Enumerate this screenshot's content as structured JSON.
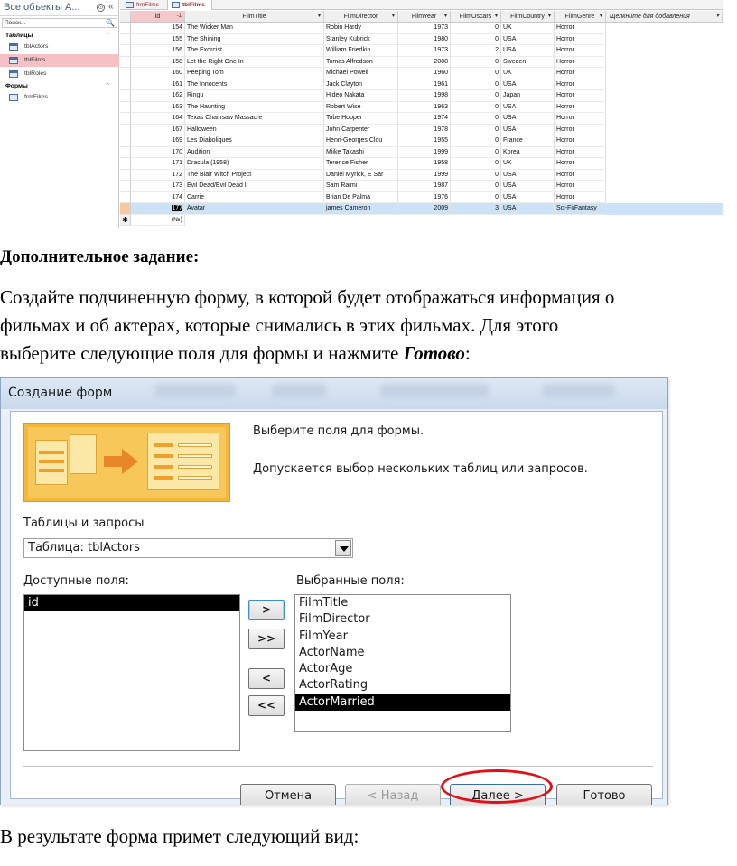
{
  "access": {
    "nav": {
      "title": "Все объекты A...",
      "ctl_circle": "⊙",
      "ctl_collapse": "«",
      "search_placeholder": "Поиск...",
      "search_icon": "🔍",
      "groups": [
        {
          "label": "Таблицы",
          "chevron": "⌃",
          "items": [
            "tblActors",
            "tblFilms",
            "tblRoles"
          ]
        },
        {
          "label": "Формы",
          "chevron": "⌃",
          "items": [
            "frmFilms"
          ]
        }
      ],
      "selected_item": "tblFilms"
    },
    "tabs": [
      {
        "label": "frmFilms",
        "active": false
      },
      {
        "label": "tblFilms",
        "active": true
      }
    ],
    "columns": [
      {
        "label": "id",
        "dd": "-1"
      },
      {
        "label": "FilmTitle",
        "dd": "▾"
      },
      {
        "label": "FilmDirector",
        "dd": "▾"
      },
      {
        "label": "FilmYear",
        "dd": "▾"
      },
      {
        "label": "FilmOscars",
        "dd": "▾"
      },
      {
        "label": "FilmCountry",
        "dd": "▾"
      },
      {
        "label": "FilmGenre",
        "dd": "▾"
      },
      {
        "label": "Щелкните для добавления",
        "dd": "▾"
      }
    ],
    "rows": [
      [
        "154",
        "The Wicker Man",
        "Robin Hardy",
        "1973",
        "0",
        "UK",
        "Horror"
      ],
      [
        "155",
        "The Shining",
        "Stanley Kubrick",
        "1980",
        "0",
        "USA",
        "Horror"
      ],
      [
        "156",
        "The Exorcist",
        "William Friedkin",
        "1973",
        "2",
        "USA",
        "Horror"
      ],
      [
        "158",
        "Let the Right One In",
        "Tomas Alfredson",
        "2008",
        "0",
        "Sweden",
        "Horror"
      ],
      [
        "160",
        "Peeping Tom",
        "Michael Powell",
        "1960",
        "0",
        "UK",
        "Horror"
      ],
      [
        "161",
        "The Innocents",
        "Jack Clayton",
        "1961",
        "0",
        "USA",
        "Horror"
      ],
      [
        "162",
        "Ringu",
        "Hideo Nakata",
        "1998",
        "0",
        "Japan",
        "Horror"
      ],
      [
        "163",
        "The Haunting",
        "Robert Wise",
        "1963",
        "0",
        "USA",
        "Horror"
      ],
      [
        "164",
        "Texas Chainsaw Massacre",
        "Tobe Hooper",
        "1974",
        "0",
        "USA",
        "Horror"
      ],
      [
        "167",
        "Halloween",
        "John Carpenter",
        "1978",
        "0",
        "USA",
        "Horror"
      ],
      [
        "169",
        "Les Diaboliques",
        "Henri-Georges Clou",
        "1955",
        "0",
        "France",
        "Horror"
      ],
      [
        "170",
        "Audition",
        "Miike Takashi",
        "1999",
        "0",
        "Korea",
        "Horror"
      ],
      [
        "171",
        "Dracula   (1958)",
        "Terence Fisher",
        "1958",
        "0",
        "UK",
        "Horror"
      ],
      [
        "172",
        "The Blair Witch Project",
        "Daniel Myrick, E Sar",
        "1999",
        "0",
        "USA",
        "Horror"
      ],
      [
        "173",
        "Evil Dead/Evil Dead II",
        "Sam Raimi",
        "1987",
        "0",
        "USA",
        "Horror"
      ],
      [
        "174",
        "Carrie",
        "Brian De Palma",
        "1976",
        "0",
        "USA",
        "Horror"
      ],
      [
        "177",
        "Avatar",
        "james Cameron",
        "2009",
        "3",
        "USA",
        "Sci-Fi/Fantasy"
      ]
    ],
    "selected_row": 16,
    "new_row_marker": "✱",
    "new_row_id": "(№)"
  },
  "text": {
    "heading": "Дополнительное задание:",
    "body_line1": "Создайте подчиненную форму, в которой будет отображаться информация о",
    "body_line2": "фильмах и об актерах, которые снимались в этих фильмах. Для этого",
    "body_line3_pre": "выберите следующие поля для формы и нажмите ",
    "body_line3_em": "Готово",
    "body_line3_post": ":",
    "result": "В результате форма примет следующий вид:"
  },
  "wizard": {
    "title": "Создание форм",
    "instruction1": "Выберите поля для формы.",
    "instruction2": "Допускается выбор нескольких таблиц или запросов.",
    "tables_label": "Таблицы и запросы",
    "tables_value": "Таблица: tblActors",
    "available_label": "Доступные поля:",
    "selected_label": "Выбранные поля:",
    "available_fields": [
      "id"
    ],
    "selected_fields": [
      "FilmTitle",
      "FilmDirector",
      "FilmYear",
      "ActorName",
      "ActorAge",
      "ActorRating",
      "ActorMarried"
    ],
    "highlighted_selected": "ActorMarried",
    "move_buttons": [
      ">",
      ">>",
      "<",
      "<<"
    ],
    "buttons": {
      "cancel": "Отмена",
      "back": "< Назад",
      "next": "Далее >",
      "finish": "Готово"
    },
    "highlight_color": "#e0101a"
  }
}
